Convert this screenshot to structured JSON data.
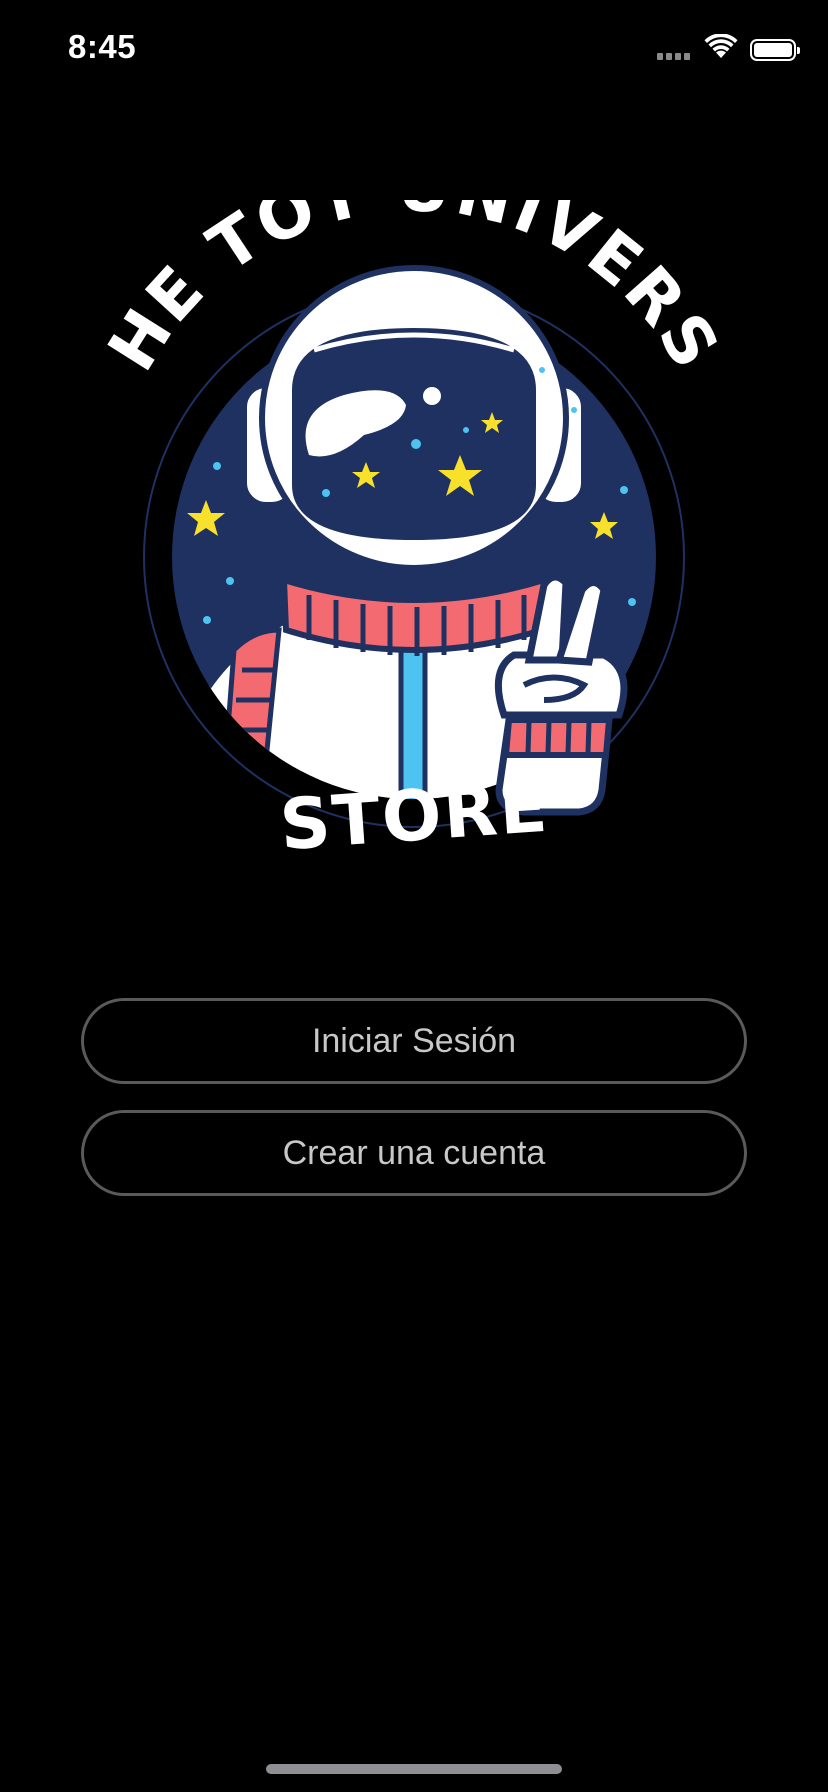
{
  "status_bar": {
    "time": "8:45",
    "signal_icon": "signal-dots-icon",
    "wifi_icon": "wifi-icon",
    "battery_icon": "battery-full-icon"
  },
  "logo": {
    "text_top": "THE TOY UNIVERSE",
    "text_bottom": "STORE",
    "icon": "astronaut-peace-sign-icon",
    "colors": {
      "circle": "#1f3161",
      "suit": "#ffffff",
      "accent_red": "#f36b71",
      "accent_blue": "#4cc3f0",
      "stars": "#f8e02b"
    }
  },
  "buttons": {
    "login_label": "Iniciar Sesión",
    "signup_label": "Crear una cuenta"
  },
  "colors": {
    "background": "#000000",
    "button_border": "#5a5a5a",
    "button_text": "#c8c8c8"
  }
}
